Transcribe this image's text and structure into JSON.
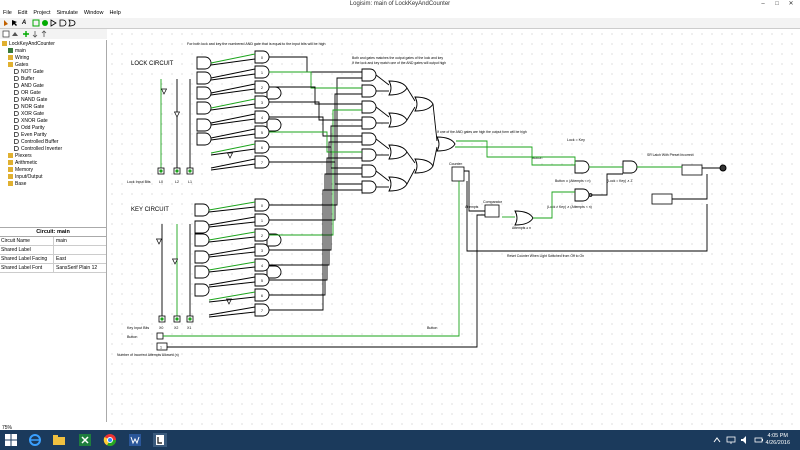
{
  "window": {
    "title": "Logisim: main of LockKeyAndCounter",
    "minimize": "–",
    "maximize": "□",
    "close": "✕"
  },
  "menu": [
    "File",
    "Edit",
    "Project",
    "Simulate",
    "Window",
    "Help"
  ],
  "explorer": {
    "items": [
      {
        "label": "LockKeyAndCounter",
        "depth": 0,
        "icon": "folder"
      },
      {
        "label": "main",
        "depth": 1,
        "icon": "circuit"
      },
      {
        "label": "Wiring",
        "depth": 1,
        "icon": "folder"
      },
      {
        "label": "Gates",
        "depth": 1,
        "icon": "folder"
      },
      {
        "label": "NOT Gate",
        "depth": 2,
        "icon": "gate"
      },
      {
        "label": "Buffer",
        "depth": 2,
        "icon": "gate"
      },
      {
        "label": "AND Gate",
        "depth": 2,
        "icon": "gate"
      },
      {
        "label": "OR Gate",
        "depth": 2,
        "icon": "gate"
      },
      {
        "label": "NAND Gate",
        "depth": 2,
        "icon": "gate"
      },
      {
        "label": "NOR Gate",
        "depth": 2,
        "icon": "gate"
      },
      {
        "label": "XOR Gate",
        "depth": 2,
        "icon": "gate"
      },
      {
        "label": "XNOR Gate",
        "depth": 2,
        "icon": "gate"
      },
      {
        "label": "Odd Parity",
        "depth": 2,
        "icon": "gate"
      },
      {
        "label": "Even Parity",
        "depth": 2,
        "icon": "gate"
      },
      {
        "label": "Controlled Buffer",
        "depth": 2,
        "icon": "gate"
      },
      {
        "label": "Controlled Inverter",
        "depth": 2,
        "icon": "gate"
      },
      {
        "label": "Plexers",
        "depth": 1,
        "icon": "folder"
      },
      {
        "label": "Arithmetic",
        "depth": 1,
        "icon": "folder"
      },
      {
        "label": "Memory",
        "depth": 1,
        "icon": "folder"
      },
      {
        "label": "Input/Output",
        "depth": 1,
        "icon": "folder"
      },
      {
        "label": "Base",
        "depth": 1,
        "icon": "folder"
      }
    ]
  },
  "attributes": {
    "title": "Circuit: main",
    "rows": [
      {
        "key": "Circuit Name",
        "value": "main"
      },
      {
        "key": "Shared Label",
        "value": ""
      },
      {
        "key": "Shared Label Facing",
        "value": "East"
      },
      {
        "key": "Shared Label Font",
        "value": "SansSerif Plain 12"
      }
    ]
  },
  "zoom": "75%",
  "canvas": {
    "note_top": "For both lock and key the numbered AND gate that is equal to the input bits will be high",
    "lock_title": "LOCK CIRCUIT",
    "key_title": "KEY CIRCUIT",
    "note_and_gates_1": "Both and gates matches the output gates of the lock and key",
    "note_and_gates_2": "If the lock and key match one of the AND gates will output high",
    "note_match": "If one of the AND gates are high the output form will be high",
    "lock_input_label": "Lock Input Bits",
    "lock_pins": [
      "L0",
      "L2",
      "L1"
    ],
    "key_input_label": "Key Input Bits",
    "key_pins": [
      "X0",
      "X2",
      "X1"
    ],
    "button_label": "Button",
    "button_label_2": "Button",
    "attempts_label": "Number of Incorrect Attempts Allowed (n)",
    "attempts_value": "1",
    "counter_label": "Counter",
    "comparator_label": "Comparator",
    "attempts_bus_label": "Attempts",
    "attempts_n_label": "Attempts ≥ n",
    "lock_key_label": "Lock = Key",
    "button_and_label": "Button ∧ (Attempts < n)",
    "lock_key_z_label": "(Lock = Key) ∧ Z",
    "lock_key_neq_label": "(Lock ≠ Key) ∧ (Attempts < n)",
    "sr_latch_label": "SR Latch With Preset Incorrect",
    "reset_label": "Reset Counter When Light Switched from Off to On",
    "gate_numbers": [
      "0",
      "1",
      "2",
      "3",
      "4",
      "5",
      "6",
      "7"
    ]
  },
  "taskbar": {
    "time": "4:05 PM",
    "date": "4/26/2016"
  }
}
